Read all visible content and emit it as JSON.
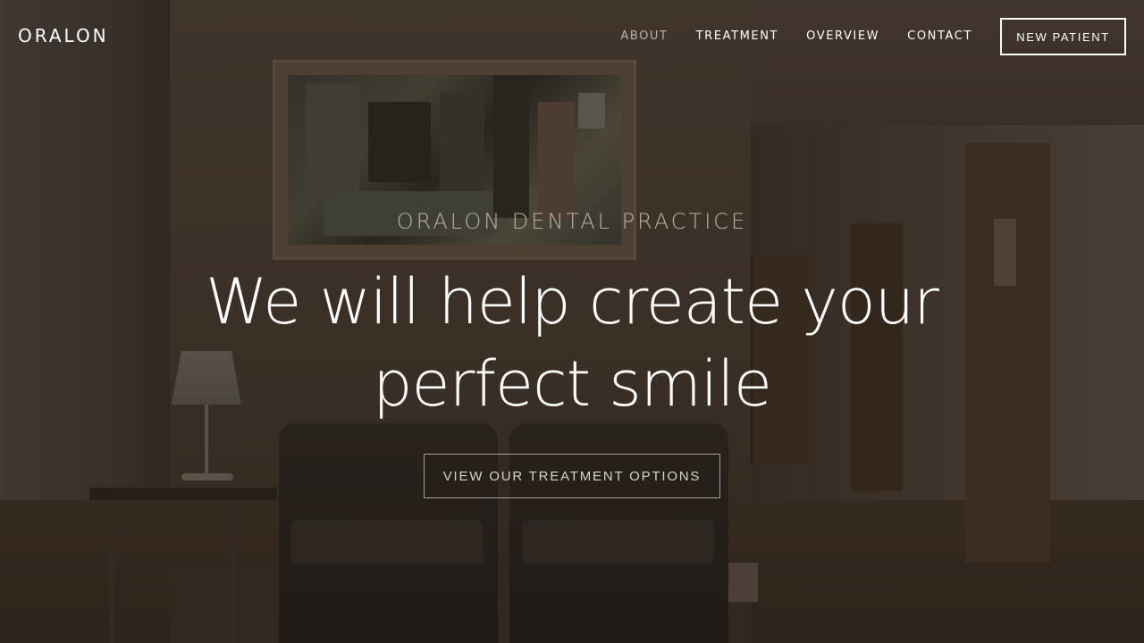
{
  "brand": {
    "logo": "ORALON"
  },
  "nav": {
    "links": [
      {
        "label": "ABOUT",
        "active": true
      },
      {
        "label": "TREATMENT",
        "active": false
      },
      {
        "label": "OVERVIEW",
        "active": false
      },
      {
        "label": "CONTACT",
        "active": false
      }
    ],
    "cta_label": "NEW PATIENT"
  },
  "hero": {
    "eyebrow": "ORALON DENTAL PRACTICE",
    "headline_line1": "We will help create your",
    "headline_line2": "perfect smile",
    "button_label": "VIEW OUR TREATMENT OPTIONS"
  },
  "colors": {
    "overlay": "#1e1610",
    "text_primary": "#ffffff",
    "text_muted": "#b9b1a8",
    "nav_active": "#b9b3ad"
  }
}
